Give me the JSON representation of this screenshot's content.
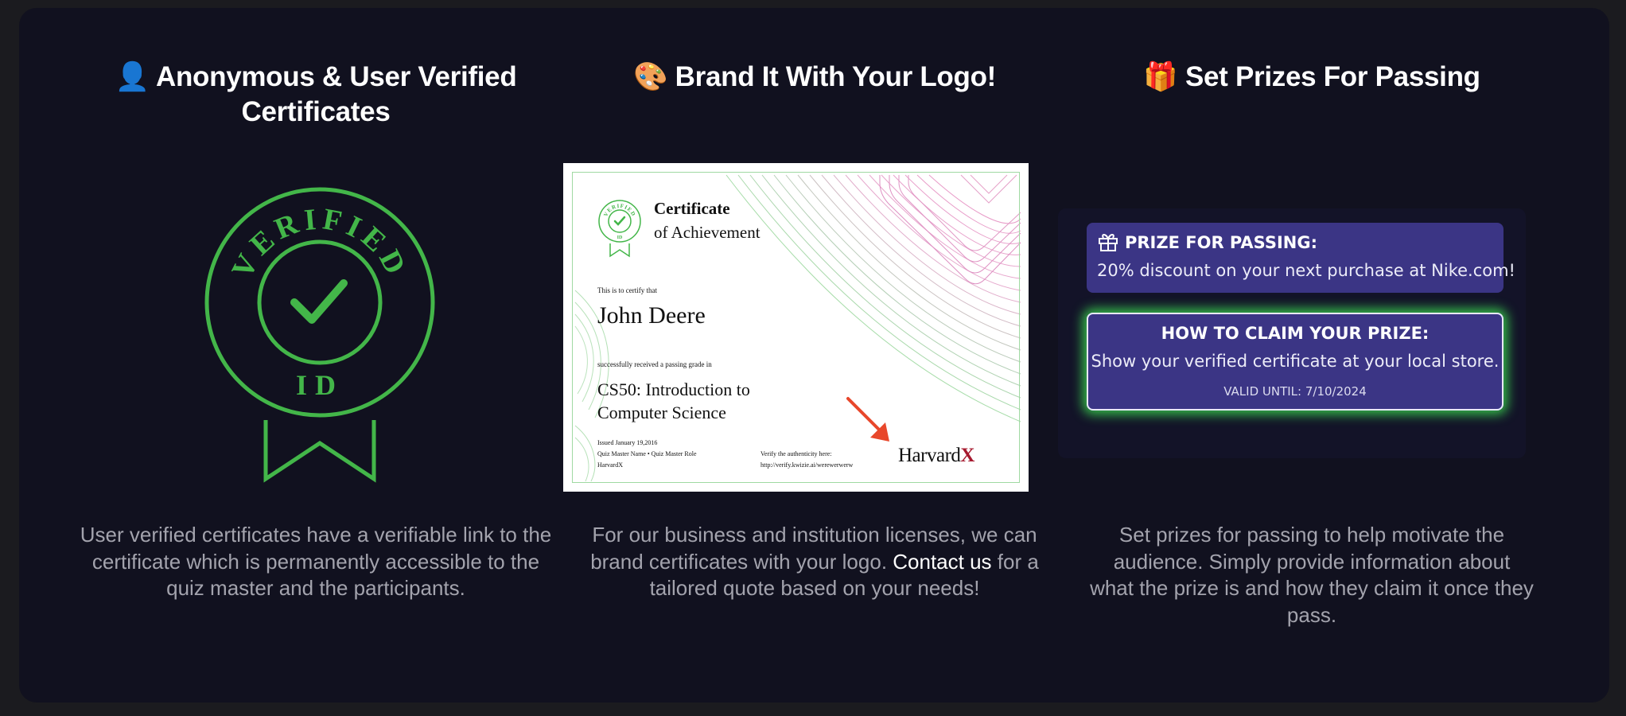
{
  "columns": [
    {
      "title_emoji": "👤",
      "title": "Anonymous & User Verified Certificates",
      "badge_top_text": "VERIFIED",
      "badge_bottom_text": "ID",
      "description": "User verified certificates have a verifiable link to the certificate which is permanently accessible to the quiz master and the participants."
    },
    {
      "title_emoji": "🎨",
      "title": "Brand It With Your Logo!",
      "description_before": "For our business and institution licenses, we can brand certificates with your logo. ",
      "link_text": "Contact us",
      "description_after": " for a tailored quote based on your needs!"
    },
    {
      "title_emoji": "🎁",
      "title": "Set Prizes For Passing",
      "description": "Set prizes for passing to help motivate the audience. Simply provide information about what the prize is and how they claim it once they pass."
    }
  ],
  "certificate": {
    "seal_top": "VERIFIED",
    "seal_bottom": "ID",
    "heading": "Certificate",
    "subheading": "of Achievement",
    "certify_line": "This is to certify that",
    "name": "John Deere",
    "passing_line": "successfully received a passing grade in",
    "course_line1": "CS50: Introduction to",
    "course_line2": "Computer Science",
    "issued": "Issued January 19,2016",
    "master": "Quiz Master Name  •  Quiz Master Role",
    "org": "HarvardX",
    "verify_label": "Verify the authenticity here:",
    "verify_url": "http://verify.kwizie.ai/werewerwerw",
    "logo_main": "Harvard",
    "logo_x": "X"
  },
  "prize": {
    "label": "PRIZE FOR PASSING:",
    "text": "20% discount on your next purchase at Nike.com!",
    "claim_label": "HOW TO CLAIM YOUR PRIZE:",
    "claim_text": "Show your verified certificate at your local store.",
    "valid_until": "VALID UNTIL: 7/10/2024"
  },
  "colors": {
    "page_bg": "#1b1b1f",
    "panel_bg": "#11111f",
    "badge_green": "#43b649",
    "prize_purple": "#3b3585",
    "glow_green": "#3cdc50",
    "arrow_red": "#e8472b"
  }
}
